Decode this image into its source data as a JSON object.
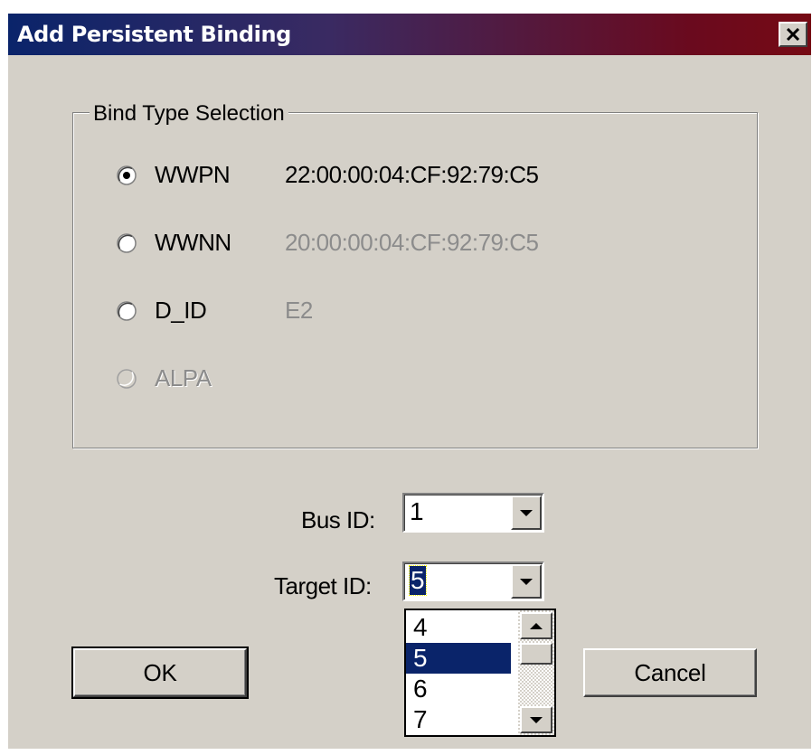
{
  "window": {
    "title": "Add Persistent Binding",
    "close_label": "✕"
  },
  "bind_type": {
    "group_label": "Bind Type Selection",
    "selected": "WWPN",
    "options": [
      {
        "label": "WWPN",
        "value": "22:00:00:04:CF:92:79:C5",
        "enabled": true,
        "checked": true
      },
      {
        "label": "WWNN",
        "value": "20:00:00:04:CF:92:79:C5",
        "enabled": true,
        "checked": false
      },
      {
        "label": "D_ID",
        "value": "E2",
        "enabled": true,
        "checked": false
      },
      {
        "label": "ALPA",
        "value": "",
        "enabled": false,
        "checked": false
      }
    ]
  },
  "bus_id": {
    "label": "Bus ID:",
    "value": "1"
  },
  "target_id": {
    "label": "Target ID:",
    "value": "5",
    "dropdown_open": true,
    "visible_options": [
      "4",
      "5",
      "6",
      "7"
    ],
    "highlighted": "5"
  },
  "buttons": {
    "ok_label": "OK",
    "cancel_label": "Cancel"
  },
  "icons": {
    "close": "close-icon",
    "combo_arrow": "chevron-down-icon",
    "scroll_up": "scroll-up-icon",
    "scroll_down": "scroll-down-icon"
  },
  "colors": {
    "title_gradient_start": "#0a246a",
    "title_gradient_end": "#760a14",
    "dialog_face": "#d4d0c8",
    "selection": "#0a246a",
    "disabled_text": "#8c8c8c"
  }
}
